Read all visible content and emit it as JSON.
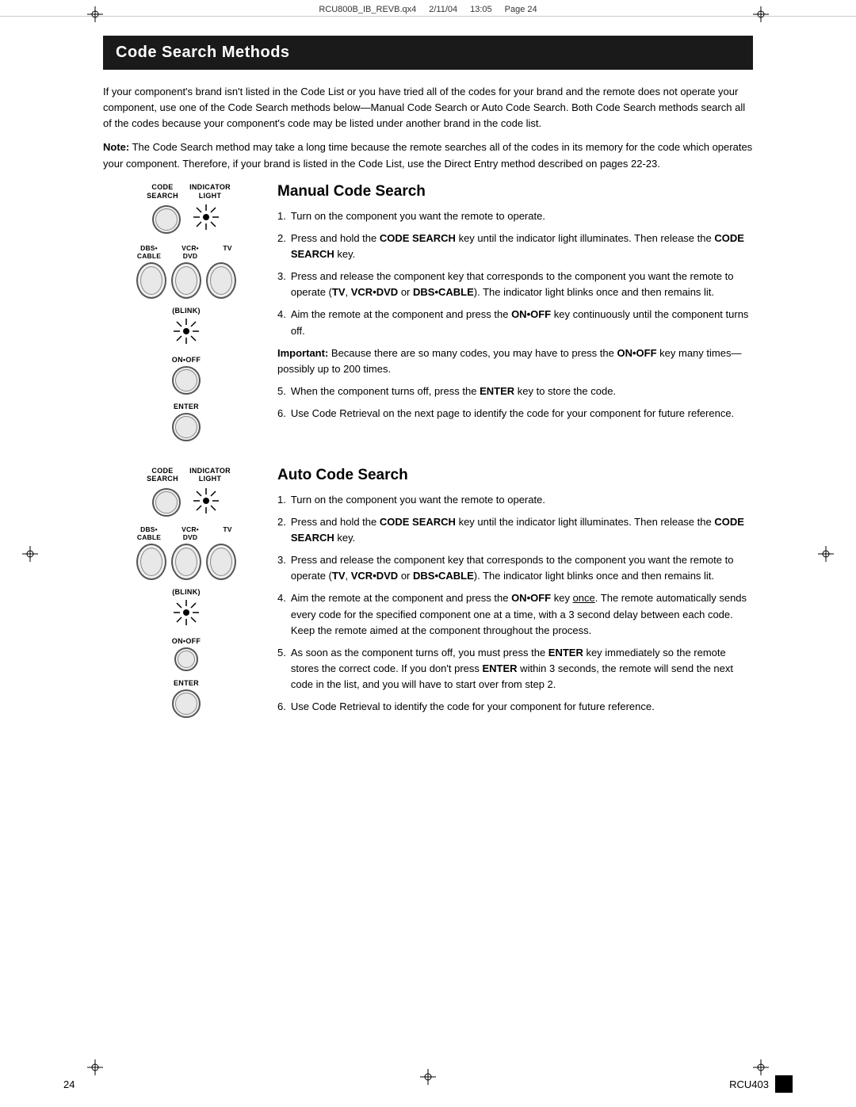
{
  "header": {
    "file": "RCU800B_IB_REVB.qx4",
    "date": "2/11/04",
    "time": "13:05",
    "page": "Page 24"
  },
  "page_title": "Code Search Methods",
  "intro_paragraphs": [
    "If your component's brand isn't listed in the Code List or you have tried all of the codes for your brand and the remote does not operate your component, use one of the Code Search methods below—Manual Code Search or Auto Code Search. Both Code Search methods search all of the codes because your component's code may be listed under another brand in the code list.",
    "Note: The Code Search method may take a long time because the remote searches all of the codes in its memory for the code which operates your component. Therefore, if your brand is listed in the Code List, use the Direct Entry method described on pages 22-23."
  ],
  "manual_section": {
    "title": "Manual Code Search",
    "steps": [
      {
        "num": "1.",
        "text": "Turn on the component you want the remote to operate."
      },
      {
        "num": "2.",
        "text": "Press and hold the CODE SEARCH key until the indicator light illuminates. Then release the CODE SEARCH key."
      },
      {
        "num": "3.",
        "text": "Press and release the component key that corresponds to the component you want the remote to operate (TV, VCR•DVD or DBS•CABLE). The indicator light blinks once and then remains lit."
      },
      {
        "num": "4.",
        "text": "Aim the remote at the component and press the ON•OFF key continuously until the component turns off."
      },
      {
        "num": "important",
        "text": "Important: Because there are so many codes, you may have to press the ON•OFF key many times—possibly up to 200 times."
      },
      {
        "num": "5.",
        "text": "When the component turns off, press the ENTER key to store the code."
      },
      {
        "num": "6.",
        "text": "Use Code Retrieval on the next page to identify the code for your component for future reference."
      }
    ],
    "diagram": {
      "top_labels": [
        "CODE SEARCH",
        "INDICATOR LIGHT"
      ],
      "component_labels": [
        "DBS• CABLE",
        "VCR• DVD",
        "TV"
      ],
      "blink_label": "(BLINK)",
      "on_off_label": "ON•OFF",
      "enter_label": "ENTER"
    }
  },
  "auto_section": {
    "title": "Auto Code Search",
    "steps": [
      {
        "num": "1.",
        "text": "Turn on the component you want the remote to operate."
      },
      {
        "num": "2.",
        "text": "Press and hold the CODE SEARCH key until the indicator light illuminates. Then release the CODE SEARCH key."
      },
      {
        "num": "3.",
        "text": "Press and release the component key that corresponds to the component you want the remote to operate (TV, VCR•DVD or DBS•CABLE). The indicator light blinks once and then remains lit."
      },
      {
        "num": "4.",
        "text": "Aim the remote at the component and press the ON•OFF key once. The remote automatically sends every code for the specified component one at a time, with a 3 second delay between each code. Keep the remote aimed at the component throughout the process."
      },
      {
        "num": "5.",
        "text": "As soon as the component turns off, you must press the ENTER key immediately so the remote stores the correct code. If you don't press ENTER within 3 seconds, the remote will send the next code in the list, and you will have to start over from step 2."
      },
      {
        "num": "6.",
        "text": "Use Code Retrieval to identify the code for your component for future reference."
      }
    ],
    "diagram": {
      "top_labels": [
        "CODE SEARCH",
        "INDICATOR LIGHT"
      ],
      "component_labels": [
        "DBS• CABLE",
        "VCR• DVD",
        "TV"
      ],
      "blink_label": "(BLINK)",
      "on_off_label": "ON•OFF",
      "enter_label": "ENTER"
    }
  },
  "footer": {
    "page_num": "24",
    "model": "RCU403"
  }
}
